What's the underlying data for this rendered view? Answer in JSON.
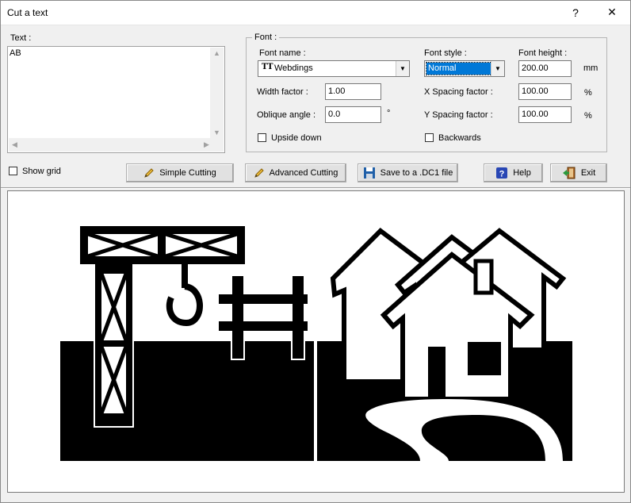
{
  "window": {
    "title": "Cut a text",
    "help_glyph": "?",
    "close_glyph": "✕"
  },
  "text_section": {
    "label": "Text :",
    "value": "AB"
  },
  "font_group": {
    "label": "Font :",
    "font_name_label": "Font name :",
    "font_name_value": "Webdings",
    "font_name_icon": "truetype-icon",
    "font_style_label": "Font style :",
    "font_style_value": "Normal",
    "font_height_label": "Font height :",
    "font_height_value": "200.00",
    "font_height_unit": "mm",
    "width_factor_label": "Width factor :",
    "width_factor_value": "1.00",
    "x_spacing_label": "X Spacing factor :",
    "x_spacing_value": "100.00",
    "x_spacing_unit": "%",
    "oblique_label": "Oblique angle :",
    "oblique_value": "0.0",
    "oblique_unit": "°",
    "y_spacing_label": "Y Spacing factor :",
    "y_spacing_value": "100.00",
    "y_spacing_unit": "%",
    "upside_down_label": "Upside down",
    "backwards_label": "Backwards"
  },
  "toolbar": {
    "show_grid_label": "Show grid",
    "simple_cutting_label": "Simple Cutting",
    "advanced_cutting_label": "Advanced Cutting",
    "save_label": "Save to a .DC1 file",
    "help_label": "Help",
    "exit_label": "Exit"
  },
  "colors": {
    "selection": "#0078d7",
    "preview_bg": "#ffffff",
    "glyph": "#000000"
  }
}
